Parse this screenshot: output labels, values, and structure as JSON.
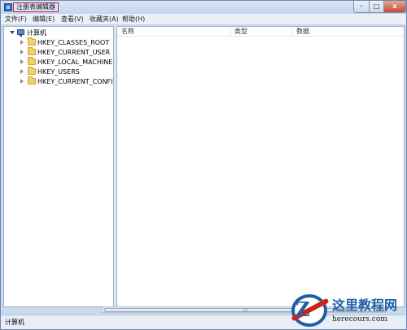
{
  "window": {
    "title": "注册表编辑器",
    "controls": {
      "minimize": "–",
      "maximize": "□",
      "close": "x"
    }
  },
  "menu": [
    "文件(F)",
    "编辑(E)",
    "查看(V)",
    "收藏夹(A)",
    "帮助(H)"
  ],
  "tree": {
    "root": "计算机",
    "keys": [
      "HKEY_CLASSES_ROOT",
      "HKEY_CURRENT_USER",
      "HKEY_LOCAL_MACHINE",
      "HKEY_USERS",
      "HKEY_CURRENT_CONFIG"
    ]
  },
  "list": {
    "columns": [
      "名称",
      "类型",
      "数据"
    ]
  },
  "status": "计算机",
  "watermark": {
    "title": "这里教程网",
    "url": "herecours.com"
  },
  "colors": {
    "accent": "#1f5fa8",
    "highlight_border": "#c2185b"
  }
}
